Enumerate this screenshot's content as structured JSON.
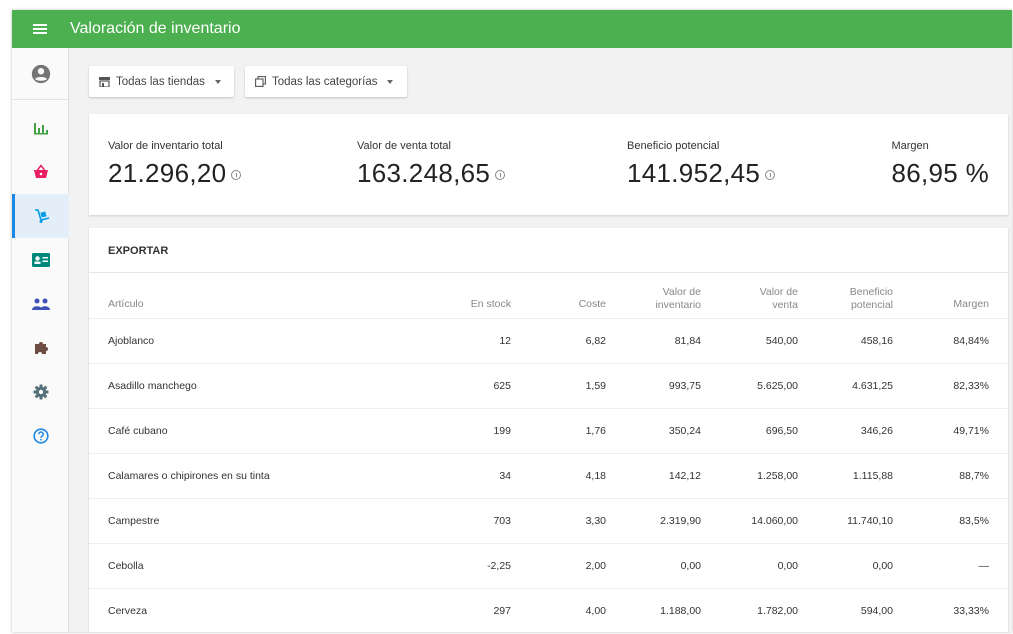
{
  "header": {
    "title": "Valoración de inventario"
  },
  "colors": {
    "topbar": "#4caf50",
    "active_accent": "#1e88e5"
  },
  "sidebar": {
    "items": [
      {
        "icon": "account-circle-icon",
        "color": "#757575",
        "active": false
      },
      {
        "icon": "bar-chart-icon",
        "color": "#43a047",
        "active": false
      },
      {
        "icon": "shopping-basket-icon",
        "color": "#e91e63",
        "active": false
      },
      {
        "icon": "dolly-inventory-icon",
        "color": "#039be5",
        "active": true
      },
      {
        "icon": "id-card-icon",
        "color": "#00897b",
        "active": false
      },
      {
        "icon": "people-icon",
        "color": "#3f51b5",
        "active": false
      },
      {
        "icon": "puzzle-icon",
        "color": "#6d4c41",
        "active": false
      },
      {
        "icon": "gear-icon",
        "color": "#546e7a",
        "active": false
      },
      {
        "icon": "help-circle-icon",
        "color": "#1e88e5",
        "active": false
      }
    ]
  },
  "filters": {
    "stores": "Todas las tiendas",
    "categories": "Todas las categorías"
  },
  "summary": {
    "inventory_value_label": "Valor de inventario total",
    "inventory_value": "21.296,20",
    "sale_value_label": "Valor de venta total",
    "sale_value": "163.248,65",
    "profit_label": "Beneficio potencial",
    "profit": "141.952,45",
    "margin_label": "Margen",
    "margin": "86,95 %"
  },
  "table": {
    "export_label": "EXPORTAR",
    "headers": {
      "item": "Artículo",
      "stock": "En stock",
      "cost": "Coste",
      "inventory_value_1": "Valor de",
      "inventory_value_2": "inventario",
      "sale_value_1": "Valor de",
      "sale_value_2": "venta",
      "profit_1": "Beneficio",
      "profit_2": "potencial",
      "margin": "Margen"
    },
    "rows": [
      {
        "name": "Ajoblanco",
        "stock": "12",
        "cost": "6,82",
        "inv_value": "81,84",
        "sale_value": "540,00",
        "profit": "458,16",
        "margin": "84,84%"
      },
      {
        "name": "Asadillo manchego",
        "stock": "625",
        "cost": "1,59",
        "inv_value": "993,75",
        "sale_value": "5.625,00",
        "profit": "4.631,25",
        "margin": "82,33%"
      },
      {
        "name": "Café cubano",
        "stock": "199",
        "cost": "1,76",
        "inv_value": "350,24",
        "sale_value": "696,50",
        "profit": "346,26",
        "margin": "49,71%"
      },
      {
        "name": "Calamares o chipirones en su tinta",
        "stock": "34",
        "cost": "4,18",
        "inv_value": "142,12",
        "sale_value": "1.258,00",
        "profit": "1.115,88",
        "margin": "88,7%"
      },
      {
        "name": "Campestre",
        "stock": "703",
        "cost": "3,30",
        "inv_value": "2.319,90",
        "sale_value": "14.060,00",
        "profit": "11.740,10",
        "margin": "83,5%"
      },
      {
        "name": "Cebolla",
        "stock": "-2,25",
        "cost": "2,00",
        "inv_value": "0,00",
        "sale_value": "0,00",
        "profit": "0,00",
        "margin": "—"
      },
      {
        "name": "Cerveza",
        "stock": "297",
        "cost": "4,00",
        "inv_value": "1.188,00",
        "sale_value": "1.782,00",
        "profit": "594,00",
        "margin": "33,33%"
      }
    ]
  }
}
